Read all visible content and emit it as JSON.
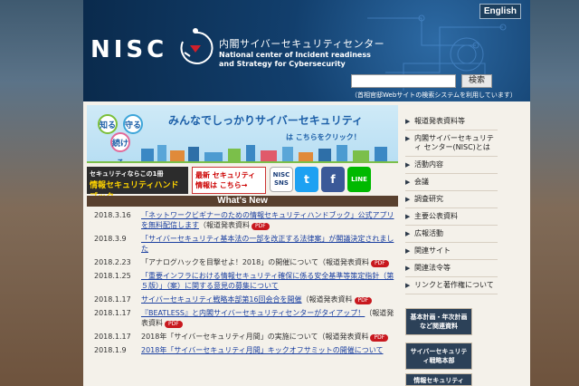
{
  "header": {
    "english_label": "English",
    "logo_text": "NISC",
    "jp_title": "内閣サイバーセキュリティセンター",
    "en_title": "National center of Incident readiness and Strategy for Cybersecurity",
    "search_button": "検索",
    "search_note": "（首相官邸Webサイトの検索システムを利用しています）"
  },
  "banner": {
    "circles": [
      "知る",
      "守る",
      "続ける"
    ],
    "headline": "みんなでしっかりサイバーセキュリティ",
    "sub": "は こちらをクリック！"
  },
  "sub_banners": {
    "handbook_top": "セキュリティならこの1冊",
    "handbook_main": "情報セキュリティハンドブック",
    "handbook_note": "は こちら",
    "latest": "最新 セキュリティ情報は こちら→",
    "nisc_sns": "NISC SNS",
    "twitter": "t",
    "facebook": "f",
    "line": "LINE"
  },
  "whats_new_label": "What's New",
  "news": [
    {
      "date": "2018.3.16",
      "text": "「ネットワークビギナーのための情報セキュリティハンドブック」公式アプリを無料配信します",
      "tag": "（報道発表資料",
      "pdf": "PDF"
    },
    {
      "date": "2018.3.9",
      "text": "「サイバーセキュリティ基本法の一部を改正する法律案」が閣議決定されました",
      "tag": "",
      "pdf": ""
    },
    {
      "date": "2018.2.23",
      "text": "「アナログハックを目撃せよ！2018」の開催について",
      "tag": "（報道発表資料",
      "pdf": "PDF"
    },
    {
      "date": "2018.1.25",
      "text": "「重要インフラにおける情報セキュリティ確保に係る安全基準等策定指針（第５版）」（案）に関する意見の募集について",
      "tag": "",
      "pdf": ""
    },
    {
      "date": "2018.1.17",
      "text": "サイバーセキュリティ戦略本部第16回会合を開催",
      "tag": "（報道発表資料",
      "pdf": "PDF"
    },
    {
      "date": "2018.1.17",
      "text": "『BEATLESS』と内閣サイバーセキュリティセンターがタイアップ！",
      "tag": "（報道発表資料",
      "pdf": "PDF"
    },
    {
      "date": "2018.1.17",
      "text": "2018年「サイバーセキュリティ月間」の実施について",
      "tag": "（報道発表資料",
      "pdf": "PDF"
    },
    {
      "date": "2018.1.9",
      "text": "2018年「サイバーセキュリティ月間」キックオフサミットの開催について",
      "tag": "",
      "pdf": ""
    }
  ],
  "nav": [
    "報道発表資料等",
    "内閣サイバーセキュリティ センター(NISC)とは",
    "活動内容",
    "会議",
    "調査研究",
    "主要公表資料",
    "広報活動",
    "関連サイト",
    "関連法令等",
    "リンクと著作権について"
  ],
  "side_boxes": [
    "基本計画・年次計画など関連資料",
    "サイバーセキュリティ戦略本部",
    "情報セキュリティ"
  ],
  "colors": {
    "header": "#123f6d",
    "nav_bg": "#f4f1ea",
    "news_link": "#1a3fa0",
    "pdf_badge": "#c8181e"
  }
}
